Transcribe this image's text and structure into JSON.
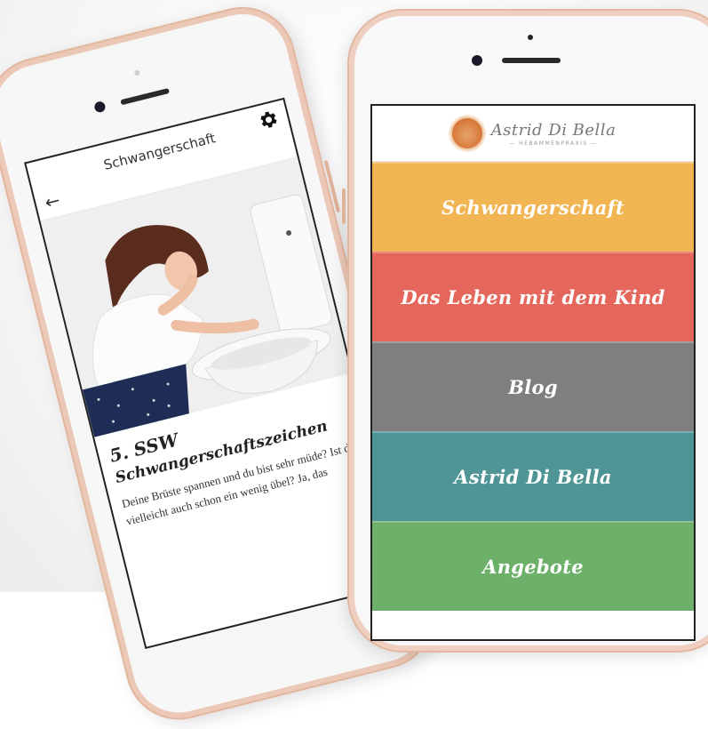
{
  "left_phone": {
    "screen": {
      "title": "Schwangerschaft",
      "back_symbol": "←",
      "article": {
        "week": "5. SSW",
        "heading": "Schwangerschaftszeichen",
        "body": "Deine Brüste spannen und du bist sehr müde? Ist dir vielleicht auch schon ein wenig übel? Ja, das"
      }
    }
  },
  "right_phone": {
    "brand": {
      "name": "Astrid Di Bella",
      "subtitle": "— HEBAMMENPRAXIS —"
    },
    "menu": [
      {
        "label": "Schwangerschaft",
        "color": "#f2b553"
      },
      {
        "label": "Das Leben mit dem Kind",
        "color": "#e5675c"
      },
      {
        "label": "Blog",
        "color": "#7f7f80"
      },
      {
        "label": "Astrid Di Bella",
        "color": "#4f9595"
      },
      {
        "label": "Angebote",
        "color": "#6db06a"
      }
    ]
  },
  "colors": {
    "phone_frame": "#efcfbf",
    "accent_orange": "#d97f41"
  },
  "icons": {
    "settings": "gear-icon",
    "back": "back-arrow-icon",
    "logo": "logo-circle-icon"
  }
}
